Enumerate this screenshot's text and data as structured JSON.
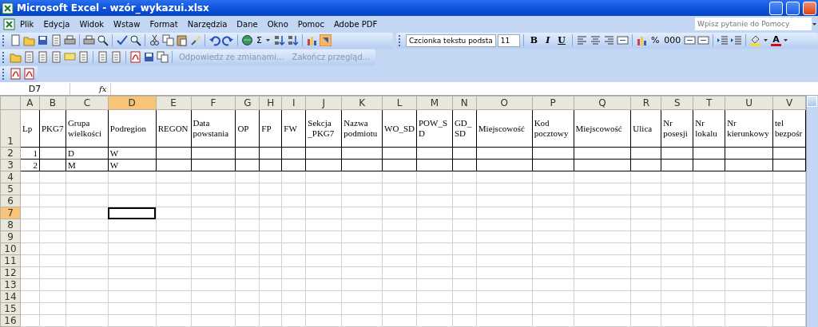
{
  "window": {
    "title": "Microsoft Excel - wzór_wykazui.xlsx"
  },
  "menu": [
    "Plik",
    "Edycja",
    "Widok",
    "Wstaw",
    "Format",
    "Narzędzia",
    "Dane",
    "Okno",
    "Pomoc",
    "Adobe PDF"
  ],
  "help_search": {
    "placeholder": "Wpisz pytanie do Pomocy"
  },
  "formatting": {
    "font": "Czcionka tekstu podsta",
    "size": "11",
    "styles": [
      {
        "label": "B",
        "kind": "bold"
      },
      {
        "label": "I",
        "kind": "italic"
      },
      {
        "label": "U",
        "kind": "underline"
      }
    ],
    "percent": "%",
    "thousands": "000",
    "font_color_label": "A"
  },
  "autosum": "Σ",
  "review_toolbar": {
    "reply": "Odpowiedz ze zmianami...",
    "end": "Zakończ przegląd..."
  },
  "formula_bar": {
    "name_box": "D7",
    "fx": "fx"
  },
  "sheet": {
    "columns": [
      {
        "label": "A",
        "selected": false
      },
      {
        "label": "B",
        "selected": false
      },
      {
        "label": "C",
        "selected": false
      },
      {
        "label": "D",
        "selected": true
      },
      {
        "label": "E",
        "selected": false
      },
      {
        "label": "F",
        "selected": false
      },
      {
        "label": "G",
        "selected": false
      },
      {
        "label": "H",
        "selected": false
      },
      {
        "label": "I",
        "selected": false
      },
      {
        "label": "J",
        "selected": false
      },
      {
        "label": "K",
        "selected": false
      },
      {
        "label": "L",
        "selected": false
      },
      {
        "label": "M",
        "selected": false
      },
      {
        "label": "N",
        "selected": false
      },
      {
        "label": "O",
        "selected": false
      },
      {
        "label": "P",
        "selected": false
      },
      {
        "label": "Q",
        "selected": false
      },
      {
        "label": "R",
        "selected": false
      },
      {
        "label": "S",
        "selected": false
      },
      {
        "label": "T",
        "selected": false
      },
      {
        "label": "U",
        "selected": false
      },
      {
        "label": "V",
        "selected": false
      }
    ],
    "rows": [
      {
        "header": "1",
        "selected": false,
        "cells": [
          "Lp",
          "PKG7",
          "Grupa wielkości",
          "Podregion",
          "REGON",
          "Data powstania",
          "OP",
          "FP",
          "FW",
          "Sekcja _PKG7",
          "Nazwa podmiotu",
          "WO_SD",
          "POW_SD",
          "GD_ SD",
          "Miejscowość",
          "Kod pocztowy",
          "Miejscowość",
          "Ulica",
          "Nr posesji",
          "Nr lokalu",
          "Nr kierunkowy",
          "tel bezpośr"
        ]
      },
      {
        "header": "2",
        "selected": false,
        "cells": [
          "1",
          null,
          "D",
          "W"
        ]
      },
      {
        "header": "3",
        "selected": false,
        "cells": [
          "2",
          null,
          "M",
          "W"
        ]
      },
      {
        "header": "4",
        "selected": false
      },
      {
        "header": "5",
        "selected": false
      },
      {
        "header": "6",
        "selected": false
      },
      {
        "header": "7",
        "selected": true
      },
      {
        "header": "8",
        "selected": false
      },
      {
        "header": "9",
        "selected": false
      },
      {
        "header": "10",
        "selected": false
      },
      {
        "header": "11",
        "selected": false
      },
      {
        "header": "12",
        "selected": false
      },
      {
        "header": "13",
        "selected": false
      },
      {
        "header": "14",
        "selected": false
      },
      {
        "header": "15",
        "selected": false
      },
      {
        "header": "16",
        "selected": false
      }
    ]
  }
}
